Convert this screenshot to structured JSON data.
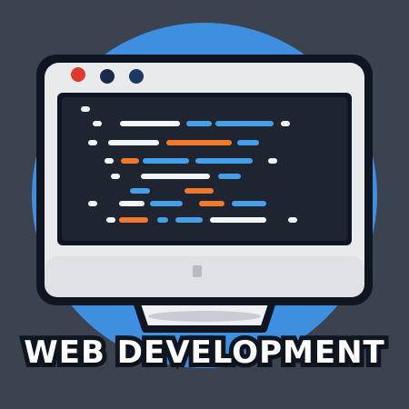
{
  "caption": "WEB DEVELOPMENT",
  "icons": {
    "monitor": "monitor-icon",
    "window_controls": [
      "close-dot",
      "minimize-dot",
      "maximize-dot"
    ],
    "code": "code-lines-icon"
  },
  "colors": {
    "background": "#3a434f",
    "circle_accent": "#3f8fe0",
    "monitor_bezel": "#e9eaec",
    "monitor_outline": "#0f1621",
    "screen": "#1e2430",
    "dot_close": "#e03a2e",
    "dot_minimize": "#1c2a4a",
    "dot_maximize": "#1c3b64",
    "code_white": "#f2f4f7",
    "code_blue": "#43a0e8",
    "code_orange": "#f07a2a",
    "caption_text": "#ffffff",
    "caption_outline": "#101620"
  }
}
